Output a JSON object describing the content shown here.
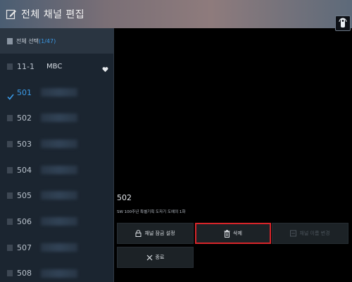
{
  "header": {
    "title": "전체 채널 편집"
  },
  "sidebar": {
    "select_all_label": "전체 선택",
    "select_all_count": "(1/47)",
    "channels": [
      {
        "number": "11-1",
        "name": "MBC",
        "checked": false,
        "favorite": true
      },
      {
        "number": "501",
        "name": "",
        "checked": true,
        "favorite": false
      },
      {
        "number": "502",
        "name": "",
        "checked": false,
        "favorite": false
      },
      {
        "number": "503",
        "name": "",
        "checked": false,
        "favorite": false
      },
      {
        "number": "504",
        "name": "",
        "checked": false,
        "favorite": false
      },
      {
        "number": "505",
        "name": "",
        "checked": false,
        "favorite": false
      },
      {
        "number": "506",
        "name": "",
        "checked": false,
        "favorite": false
      },
      {
        "number": "507",
        "name": "",
        "checked": false,
        "favorite": false
      },
      {
        "number": "508",
        "name": "",
        "checked": false,
        "favorite": false
      }
    ]
  },
  "info": {
    "channel_title": "502",
    "description": "SW 100주년 특별기획 도자기 도예의 1화"
  },
  "buttons": {
    "lock": "채널 잠금 설정",
    "delete": "삭제",
    "rename": "채널 이름 변경",
    "close": "종료"
  },
  "colors": {
    "accent": "#3b9be8",
    "highlight_border": "#d8252a"
  }
}
